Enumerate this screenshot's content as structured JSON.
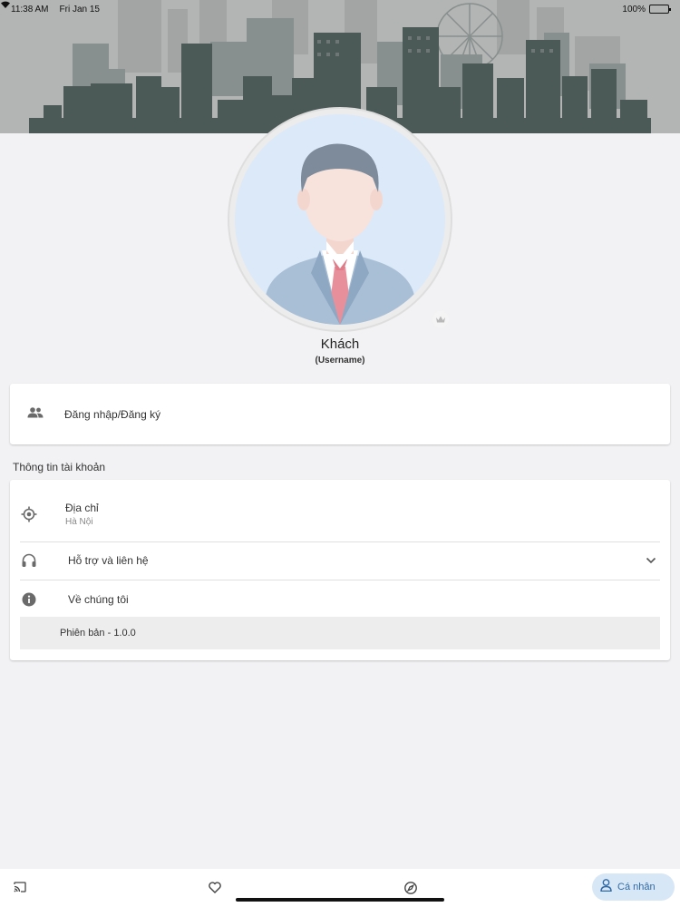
{
  "status_bar": {
    "time": "11:38 AM",
    "date": "Fri Jan 15",
    "battery": "100%",
    "wifi_icon": "wifi-icon",
    "battery_icon": "battery-icon"
  },
  "profile": {
    "name": "Khách",
    "username": "(Username)",
    "avatar_icon": "businessman-avatar",
    "badge_icon": "crown-icon"
  },
  "login": {
    "icon": "people-icon",
    "label": "Đăng nhập/Đăng ký"
  },
  "account_section": {
    "title": "Thông tin tài khoản",
    "address": {
      "icon": "location-target-icon",
      "label": "Địa chỉ",
      "value": "Hà Nội"
    },
    "support": {
      "icon": "headset-icon",
      "label": "Hỗ trợ và liên hệ",
      "chevron": "chevron-down-icon"
    },
    "about": {
      "icon": "info-icon",
      "label": "Về chúng tôi",
      "version": "Phiên bản - 1.0.0"
    }
  },
  "bottom_nav": {
    "items": [
      {
        "icon": "cast-icon"
      },
      {
        "icon": "heart-icon"
      },
      {
        "icon": "compass-icon"
      },
      {
        "icon": "person-icon",
        "label": "Cá nhân",
        "active": true
      }
    ]
  },
  "colors": {
    "header_bg": "#b3b4b4",
    "skyline_dark": "#4b5a57",
    "active_nav_bg": "#d8e7f6",
    "active_nav_text": "#2e6aa8"
  }
}
